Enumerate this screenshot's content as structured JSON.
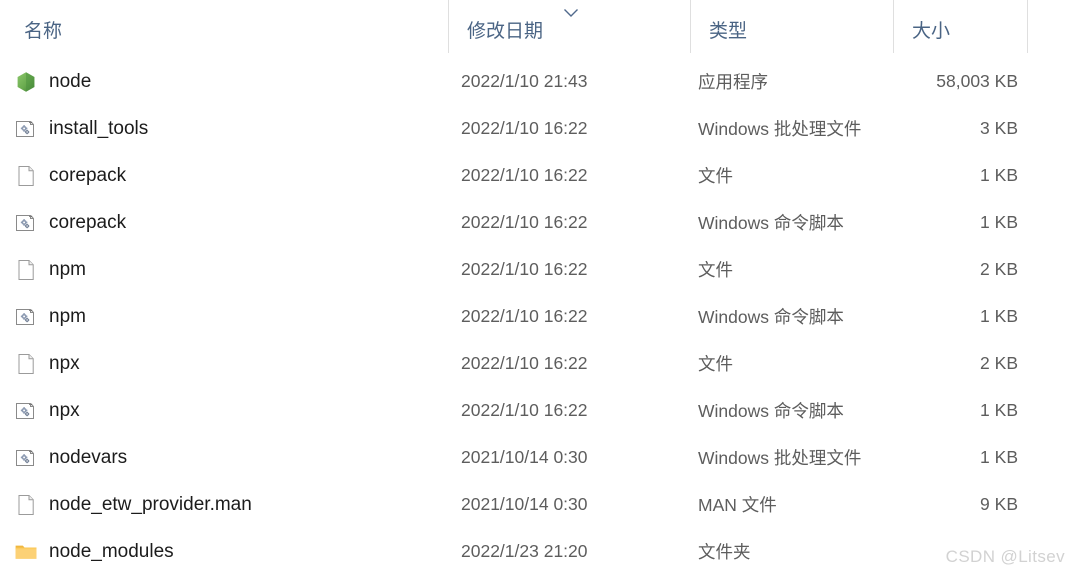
{
  "columns": [
    {
      "key": "name",
      "label": "名称",
      "sorted": false
    },
    {
      "key": "date",
      "label": "修改日期",
      "sorted": true,
      "sort_direction": "descending"
    },
    {
      "key": "type",
      "label": "类型",
      "sorted": false
    },
    {
      "key": "size",
      "label": "大小",
      "sorted": false
    }
  ],
  "files": [
    {
      "name": "node",
      "icon": "nodejs-hexagon-icon",
      "date": "2022/1/10 21:43",
      "type": "应用程序",
      "size": "58,003 KB"
    },
    {
      "name": "install_tools",
      "icon": "script-file-icon",
      "date": "2022/1/10 16:22",
      "type": "Windows 批处理文件",
      "size": "3 KB"
    },
    {
      "name": "corepack",
      "icon": "blank-document-icon",
      "date": "2022/1/10 16:22",
      "type": "文件",
      "size": "1 KB"
    },
    {
      "name": "corepack",
      "icon": "script-file-icon",
      "date": "2022/1/10 16:22",
      "type": "Windows 命令脚本",
      "size": "1 KB"
    },
    {
      "name": "npm",
      "icon": "blank-document-icon",
      "date": "2022/1/10 16:22",
      "type": "文件",
      "size": "2 KB"
    },
    {
      "name": "npm",
      "icon": "script-file-icon",
      "date": "2022/1/10 16:22",
      "type": "Windows 命令脚本",
      "size": "1 KB"
    },
    {
      "name": "npx",
      "icon": "blank-document-icon",
      "date": "2022/1/10 16:22",
      "type": "文件",
      "size": "2 KB"
    },
    {
      "name": "npx",
      "icon": "script-file-icon",
      "date": "2022/1/10 16:22",
      "type": "Windows 命令脚本",
      "size": "1 KB"
    },
    {
      "name": "nodevars",
      "icon": "script-file-icon",
      "date": "2021/10/14 0:30",
      "type": "Windows 批处理文件",
      "size": "1 KB"
    },
    {
      "name": "node_etw_provider.man",
      "icon": "blank-document-icon",
      "date": "2021/10/14 0:30",
      "type": "MAN 文件",
      "size": "9 KB"
    },
    {
      "name": "node_modules",
      "icon": "folder-icon",
      "date": "2022/1/23 21:20",
      "type": "文件夹",
      "size": ""
    }
  ],
  "watermark": "CSDN @Litsev",
  "colors": {
    "header_text": "#4a6484",
    "file_name_text": "#1c1c1c",
    "meta_text": "#5d5d5d",
    "separator": "#dfdfdf",
    "folder_icon": "#fcc75b",
    "node_icon": "#6cab52",
    "watermark": "#d2d2d2"
  }
}
